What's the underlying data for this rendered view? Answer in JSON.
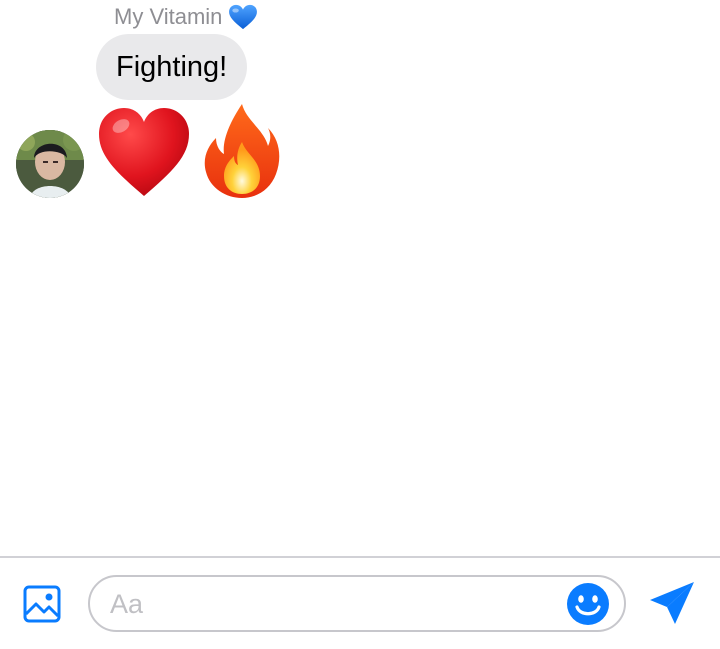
{
  "conversation": {
    "sender_name": "My Vitamin",
    "sender_name_emoji_icon": "blue-heart-icon",
    "messages": [
      {
        "type": "text",
        "text": "Fighting!"
      },
      {
        "type": "emoji",
        "icons": [
          "red-heart-icon",
          "fire-icon"
        ]
      }
    ]
  },
  "composer": {
    "placeholder": "Aa",
    "photo_icon": "photo-icon",
    "emoji_icon": "smiley-icon",
    "send_icon": "send-icon"
  },
  "colors": {
    "accent": "#0a7cff",
    "bubble": "#e9e9eb",
    "muted_text": "#8e8e93",
    "divider": "#d1d1d6"
  }
}
